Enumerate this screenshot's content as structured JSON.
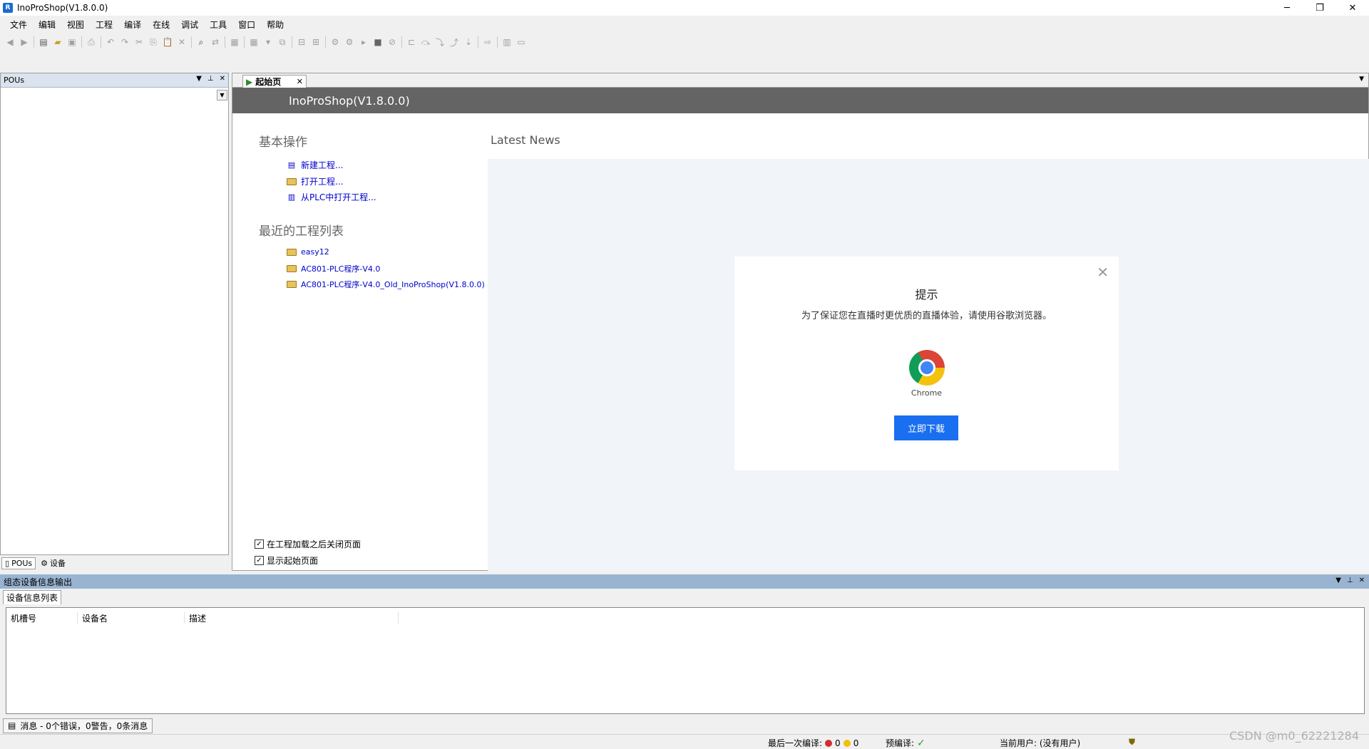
{
  "window": {
    "title": "InoProShop(V1.8.0.0)",
    "app_icon_text": "R",
    "minimize": "─",
    "restore": "❐",
    "close": "✕"
  },
  "menu": [
    "文件",
    "编辑",
    "视图",
    "工程",
    "编译",
    "在线",
    "调试",
    "工具",
    "窗口",
    "帮助"
  ],
  "pou_pane": {
    "title": "POUs",
    "tabs": [
      {
        "label": "POUs"
      },
      {
        "label": "设备"
      }
    ]
  },
  "doc": {
    "tab_label": "起始页",
    "header": "InoProShop(V1.8.0.0)",
    "basic_ops_title": "基本操作",
    "basic_ops": [
      {
        "label": "新建工程...",
        "icon": "new-file-icon"
      },
      {
        "label": "打开工程...",
        "icon": "folder-open-icon"
      },
      {
        "label": "从PLC中打开工程...",
        "icon": "plc-icon"
      }
    ],
    "recent_title": "最近的工程列表",
    "recent": [
      {
        "label": "easy12"
      },
      {
        "label": "AC801-PLC程序-V4.0"
      },
      {
        "label": "AC801-PLC程序-V4.0_Old_InoProShop(V1.8.0.0)"
      }
    ],
    "news_title": "Latest News",
    "checkboxes": [
      {
        "label": "在工程加载之后关闭页面",
        "checked": true
      },
      {
        "label": "显示起始页面",
        "checked": true
      }
    ]
  },
  "modal": {
    "title": "提示",
    "message": "为了保证您在直播时更优质的直播体验，请使用谷歌浏览器。",
    "browser_label": "Chrome",
    "button": "立即下载",
    "close_glyph": "✕"
  },
  "output_pane": {
    "title": "组态设备信息输出",
    "subtab": "设备信息列表",
    "columns": [
      "机槽号",
      "设备名",
      "描述"
    ]
  },
  "message_tab": {
    "label": "消息 - 0个错误，0警告，0条消息"
  },
  "statusbar": {
    "last_compile_label": "最后一次编译:",
    "errors": "0",
    "warnings": "0",
    "precompile_label": "预编译:",
    "precompile_ok": "✓",
    "current_user": "当前用户: (没有用户)"
  },
  "watermark": "CSDN @m0_62221284",
  "colors": {
    "header_bg": "#646464",
    "link": "#0000cc",
    "button": "#1a6ff0",
    "output_head": "#99b4d1"
  }
}
